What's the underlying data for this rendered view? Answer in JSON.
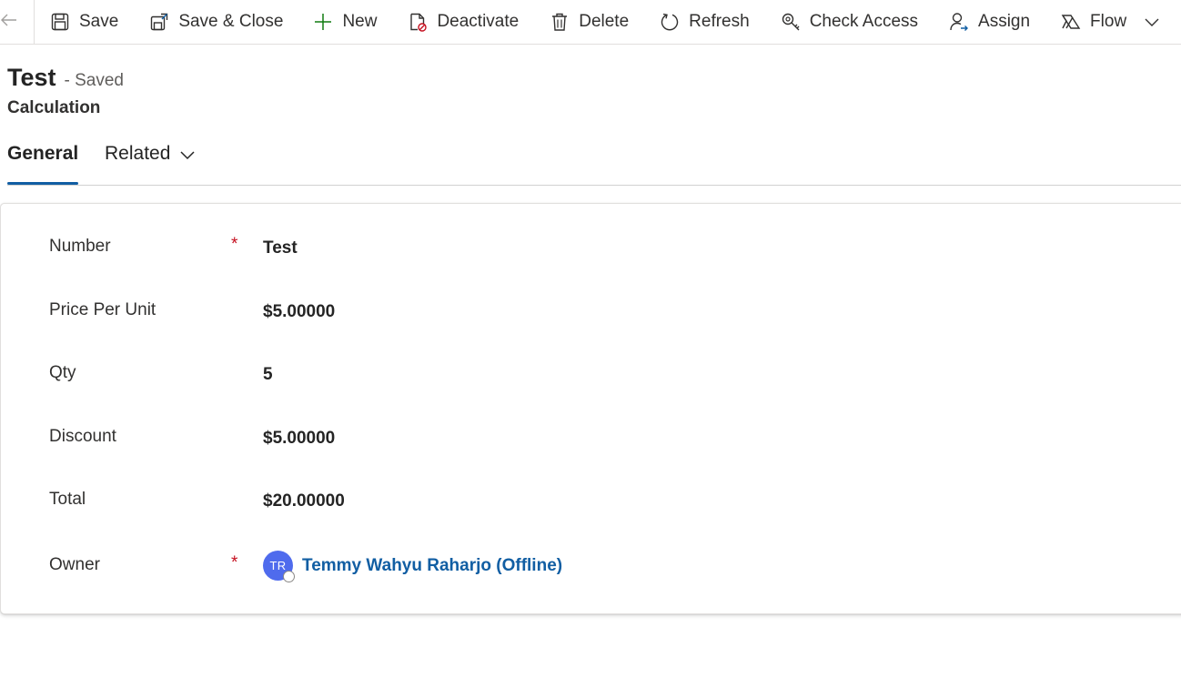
{
  "commands": {
    "save": "Save",
    "save_close": "Save & Close",
    "new": "New",
    "deactivate": "Deactivate",
    "delete": "Delete",
    "refresh": "Refresh",
    "check_access": "Check Access",
    "assign": "Assign",
    "flow": "Flow"
  },
  "header": {
    "title": "Test",
    "status": "- Saved",
    "entity": "Calculation"
  },
  "tabs": [
    {
      "label": "General",
      "selected": true
    },
    {
      "label": "Related",
      "selected": false
    }
  ],
  "form": {
    "fields": [
      {
        "label": "Number",
        "value": "Test",
        "required": true
      },
      {
        "label": "Price Per Unit",
        "value": "$5.00000",
        "required": false
      },
      {
        "label": "Qty",
        "value": "5",
        "required": false
      },
      {
        "label": "Discount",
        "value": "$5.00000",
        "required": false
      },
      {
        "label": "Total",
        "value": "$20.00000",
        "required": false
      }
    ],
    "owner": {
      "label": "Owner",
      "required": true,
      "initials": "TR",
      "name": "Temmy Wahyu Raharjo (Offline)"
    },
    "required_marker": "*"
  },
  "colors": {
    "accent": "#115ea3",
    "required": "#c50f1f",
    "avatar": "#4f6bed"
  },
  "icons": [
    "back-arrow-icon",
    "save-icon",
    "save-close-icon",
    "plus-icon",
    "deactivate-icon",
    "delete-icon",
    "refresh-icon",
    "check-access-icon",
    "assign-icon",
    "flow-icon",
    "chevron-down-icon"
  ]
}
